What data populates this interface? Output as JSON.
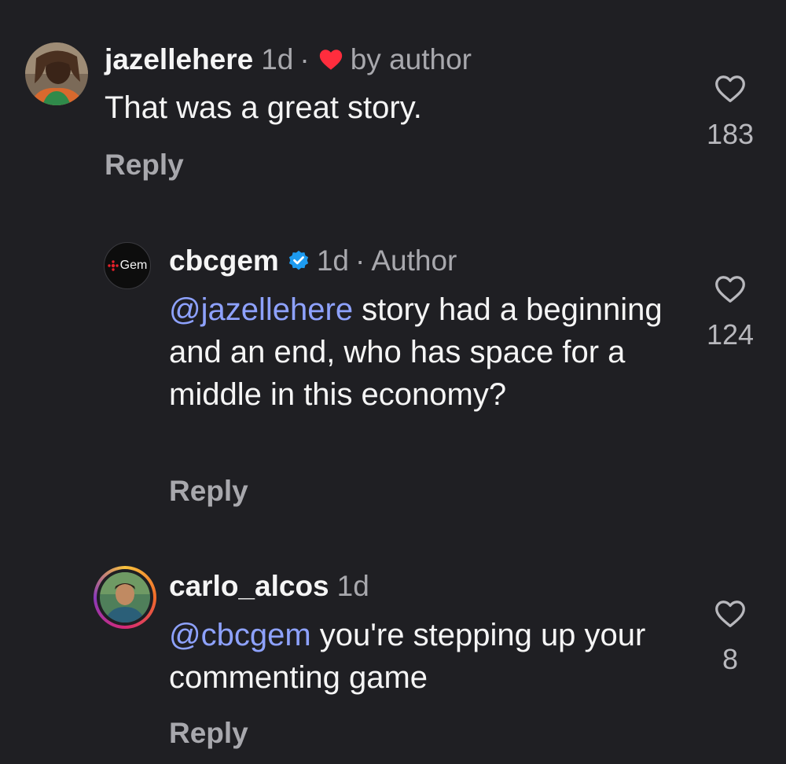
{
  "comments": [
    {
      "username": "jazellehere",
      "time": "1d",
      "separator": "·",
      "liked_by": "by author",
      "text": "That was a great story.",
      "reply_label": "Reply",
      "likes": "183"
    },
    {
      "username": "cbcgem",
      "time": "1d",
      "separator": "·",
      "role": "Author",
      "avatar_label": "Gem",
      "mention": "@jazellehere",
      "text": " story had a beginning and an end, who has space for a middle in this economy?",
      "reply_label": "Reply",
      "likes": "124"
    },
    {
      "username": "carlo_alcos",
      "time": "1d",
      "mention": "@cbcgem",
      "text": " you're stepping up your commenting game",
      "reply_label": "Reply",
      "likes": "8"
    }
  ],
  "colors": {
    "background": "#1f1f23",
    "mention": "#8ea2ff",
    "heart": "#ff2d3d",
    "verified": "#1d9bf0",
    "muted": "#a8a8ad"
  },
  "icons": [
    "heart-icon",
    "verified-badge-icon",
    "like-heart-outline-icon"
  ]
}
